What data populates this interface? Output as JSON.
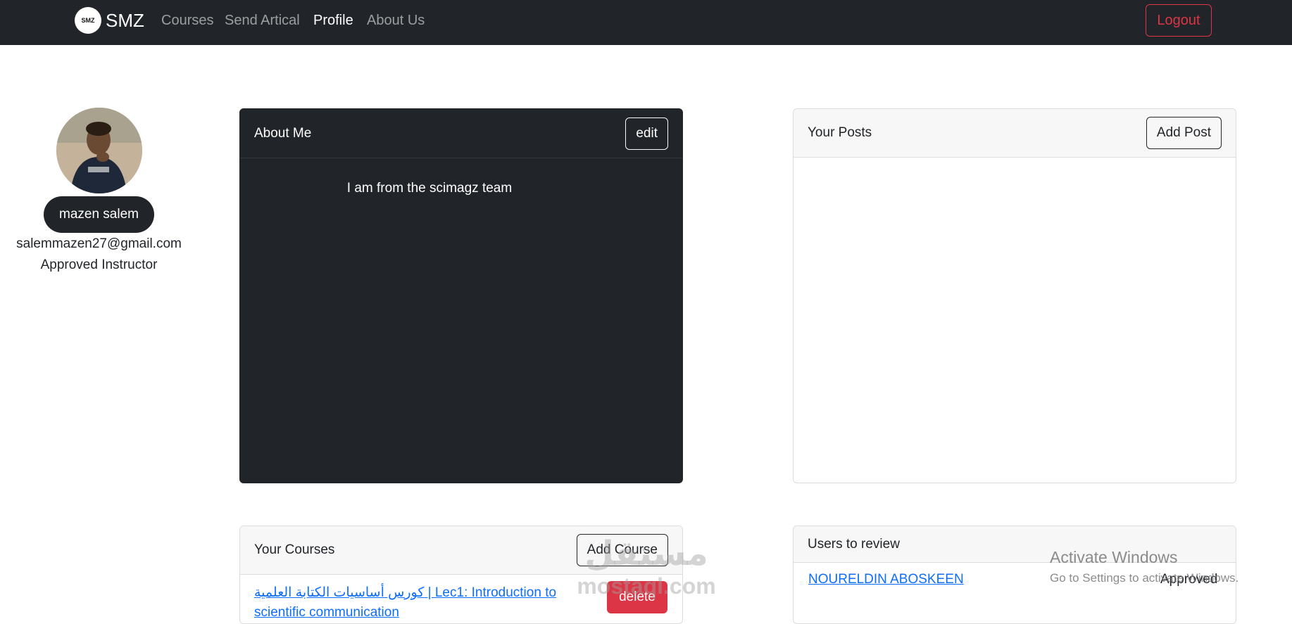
{
  "navbar": {
    "brand": "SMZ",
    "logo_text": "SMZ",
    "links": [
      {
        "label": "Courses",
        "active": false
      },
      {
        "label": "Send Artical",
        "active": false
      },
      {
        "label": "Profile",
        "active": true
      },
      {
        "label": "About Us",
        "active": false
      }
    ],
    "logout_label": "Logout"
  },
  "profile": {
    "name": "mazen salem",
    "email": "salemmazen27@gmail.com",
    "role": "Approved Instructor"
  },
  "about": {
    "title": "About Me",
    "edit_label": "edit",
    "text": "I am from the scimagz team"
  },
  "posts": {
    "title": "Your Posts",
    "add_label": "Add Post"
  },
  "courses": {
    "title": "Your Courses",
    "add_label": "Add Course",
    "items": [
      {
        "title": "كورس أساسيات الكتابة العلمية | Lec1: Introduction to scientific communication",
        "delete_label": "delete"
      }
    ]
  },
  "review": {
    "title": "Users to review",
    "users": [
      {
        "name": "NOURELDIN ABOSKEEN",
        "status": "Approved"
      }
    ]
  },
  "overlays": {
    "windows_title": "Activate Windows",
    "windows_sub": "Go to Settings to activate Windows.",
    "site_watermark_arabic": "مستقل",
    "site_watermark_latin": "mostaql.com"
  },
  "colors": {
    "navbar": "#212529",
    "danger": "#dc3545",
    "link": "#0d6efd"
  }
}
